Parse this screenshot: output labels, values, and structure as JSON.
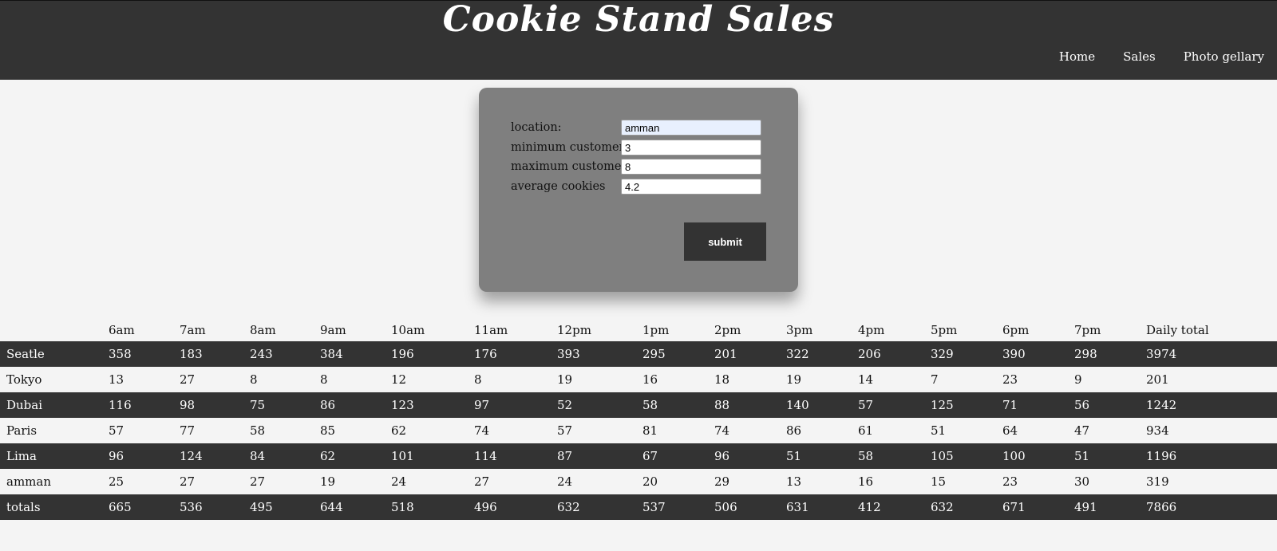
{
  "header": {
    "title": "Cookie Stand Sales",
    "nav": [
      "Home",
      "Sales",
      "Photo gellary"
    ]
  },
  "form": {
    "fields": [
      {
        "label": "location:",
        "value": "amman"
      },
      {
        "label": "minimum customers",
        "value": "3"
      },
      {
        "label": "maximum customers",
        "value": "8"
      },
      {
        "label": "average cookies",
        "value": "4.2"
      }
    ],
    "submit_label": "submit"
  },
  "table": {
    "headers": [
      "",
      "6am",
      "7am",
      "8am",
      "9am",
      "10am",
      "11am",
      "12pm",
      "1pm",
      "2pm",
      "3pm",
      "4pm",
      "5pm",
      "6pm",
      "7pm",
      "Daily total"
    ],
    "rows": [
      [
        "Seatle",
        "358",
        "183",
        "243",
        "384",
        "196",
        "176",
        "393",
        "295",
        "201",
        "322",
        "206",
        "329",
        "390",
        "298",
        "3974"
      ],
      [
        "Tokyo",
        "13",
        "27",
        "8",
        "8",
        "12",
        "8",
        "19",
        "16",
        "18",
        "19",
        "14",
        "7",
        "23",
        "9",
        "201"
      ],
      [
        "Dubai",
        "116",
        "98",
        "75",
        "86",
        "123",
        "97",
        "52",
        "58",
        "88",
        "140",
        "57",
        "125",
        "71",
        "56",
        "1242"
      ],
      [
        "Paris",
        "57",
        "77",
        "58",
        "85",
        "62",
        "74",
        "57",
        "81",
        "74",
        "86",
        "61",
        "51",
        "64",
        "47",
        "934"
      ],
      [
        "Lima",
        "96",
        "124",
        "84",
        "62",
        "101",
        "114",
        "87",
        "67",
        "96",
        "51",
        "58",
        "105",
        "100",
        "51",
        "1196"
      ],
      [
        "amman",
        "25",
        "27",
        "27",
        "19",
        "24",
        "27",
        "24",
        "20",
        "29",
        "13",
        "16",
        "15",
        "23",
        "30",
        "319"
      ],
      [
        "totals",
        "665",
        "536",
        "495",
        "644",
        "518",
        "496",
        "632",
        "537",
        "506",
        "631",
        "412",
        "632",
        "671",
        "491",
        "7866"
      ]
    ]
  }
}
